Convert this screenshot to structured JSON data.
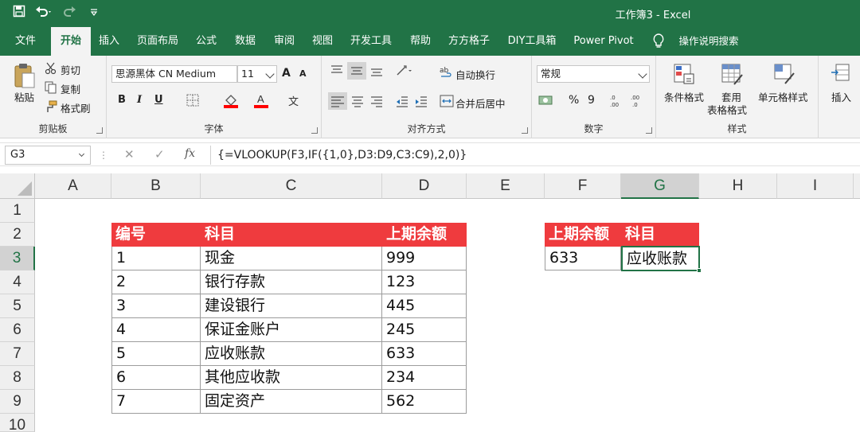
{
  "app": {
    "window_title": "工作簿3 - Excel"
  },
  "tabs": [
    {
      "label": "文件"
    },
    {
      "label": "开始"
    },
    {
      "label": "插入"
    },
    {
      "label": "页面布局"
    },
    {
      "label": "公式"
    },
    {
      "label": "数据"
    },
    {
      "label": "审阅"
    },
    {
      "label": "视图"
    },
    {
      "label": "开发工具"
    },
    {
      "label": "帮助"
    },
    {
      "label": "方方格子"
    },
    {
      "label": "DIY工具箱"
    },
    {
      "label": "Power Pivot"
    },
    {
      "label": "操作说明搜索"
    }
  ],
  "ribbon": {
    "clipboard": {
      "paste": "粘贴",
      "cut": "剪切",
      "copy": "复制",
      "format_painter": "格式刷",
      "group": "剪贴板"
    },
    "font": {
      "font_name": "思源黑体 CN Medium",
      "font_size": "11",
      "bold": "B",
      "italic": "I",
      "underline": "U",
      "grow": "A",
      "shrink": "A",
      "group": "字体"
    },
    "alignment": {
      "wrap_text": "自动换行",
      "merge_center": "合并后居中",
      "group": "对齐方式"
    },
    "number": {
      "format": "常规",
      "percent": "%",
      "comma": "9",
      "group": "数字"
    },
    "styles": {
      "conditional": "条件格式",
      "table_format_1": "套用",
      "table_format_2": "表格格式",
      "cell_styles": "单元格样式",
      "group": "样式"
    },
    "cells": {
      "insert": "插入"
    }
  },
  "formula_bar": {
    "name_box": "G3",
    "fx": "fx",
    "cancel": "✕",
    "enter": "✓",
    "formula": "{=VLOOKUP(F3,IF({1,0},D3:D9,C3:C9),2,0)}"
  },
  "sheet": {
    "columns": [
      "A",
      "B",
      "C",
      "D",
      "E",
      "F",
      "G",
      "H",
      "I"
    ],
    "rows": [
      "1",
      "2",
      "3",
      "4",
      "5",
      "6",
      "7",
      "8",
      "9",
      "10"
    ],
    "selected_cell": "G3",
    "table1": {
      "headers": [
        "编号",
        "科目",
        "上期余额"
      ],
      "rows": [
        [
          "1",
          "现金",
          "999"
        ],
        [
          "2",
          "银行存款",
          "123"
        ],
        [
          "3",
          "建设银行",
          "445"
        ],
        [
          "4",
          "保证金账户",
          "245"
        ],
        [
          "5",
          "应收账款",
          "633"
        ],
        [
          "6",
          "其他应收款",
          "234"
        ],
        [
          "7",
          "固定资产",
          "562"
        ]
      ]
    },
    "table2": {
      "headers": [
        "上期余额",
        "科目"
      ],
      "row": [
        "633",
        "应收账款"
      ]
    }
  },
  "colors": {
    "excel_green": "#217346",
    "header_red": "#ef3b3e"
  }
}
